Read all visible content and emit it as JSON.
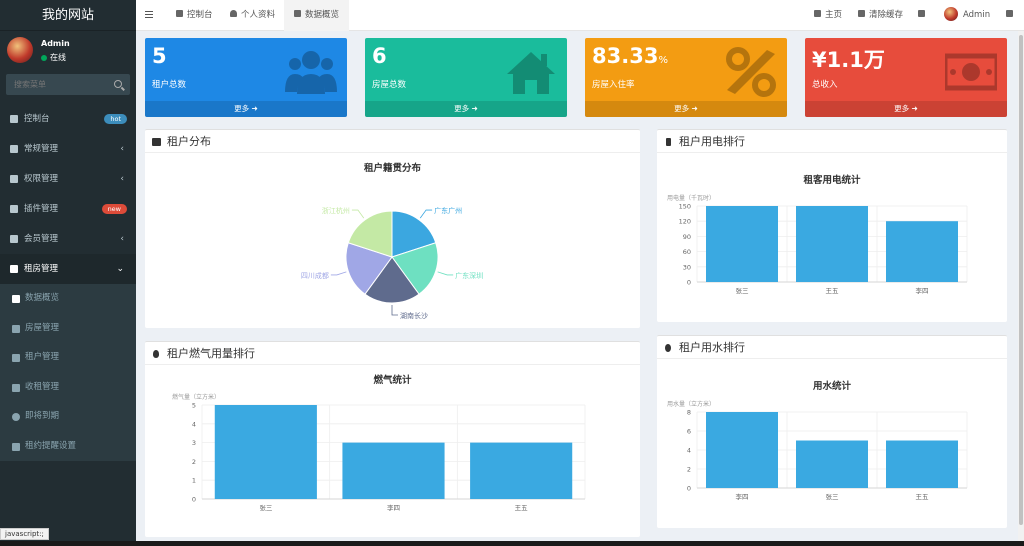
{
  "sidebar": {
    "brand": "我的网站",
    "user": {
      "name": "Admin",
      "status": "在线"
    },
    "search_placeholder": "搜索菜单",
    "items": [
      {
        "label": "控制台",
        "badge": "hot",
        "badge_color": "#3c8dbc"
      },
      {
        "label": "常规管理",
        "arrow": "‹"
      },
      {
        "label": "权限管理",
        "arrow": "‹"
      },
      {
        "label": "插件管理",
        "badge": "new",
        "badge_color": "#dd4b39"
      },
      {
        "label": "会员管理",
        "arrow": "‹"
      },
      {
        "label": "租房管理",
        "arrow": "⌄"
      }
    ],
    "subitems": [
      {
        "label": "数据概览"
      },
      {
        "label": "房屋管理"
      },
      {
        "label": "租户管理"
      },
      {
        "label": "收租管理"
      },
      {
        "label": "即将到期"
      },
      {
        "label": "租约提醒设置"
      }
    ]
  },
  "topbar": {
    "tabs": [
      {
        "label": "控制台"
      },
      {
        "label": "个人资料"
      },
      {
        "label": "数据概览"
      }
    ],
    "right": {
      "home": "主页",
      "clear_cache": "清除缓存",
      "user": "Admin"
    }
  },
  "cards": [
    {
      "value": "5",
      "unit": "",
      "label": "租户总数",
      "more": "更多",
      "color": "#1e88e5",
      "icon": "users-icon"
    },
    {
      "value": "6",
      "unit": "",
      "label": "房屋总数",
      "more": "更多",
      "color": "#1abc9c",
      "icon": "home-icon"
    },
    {
      "value": "83.33",
      "unit": "%",
      "label": "房屋入住率",
      "more": "更多",
      "color": "#f39c12",
      "icon": "percent-icon"
    },
    {
      "value": "¥1.1万",
      "unit": "",
      "label": "总收入",
      "more": "更多",
      "color": "#e74c3c",
      "icon": "money-icon"
    }
  ],
  "panels": {
    "tenant_dist": {
      "title": "租户分布"
    },
    "electric": {
      "title": "租户用电排行"
    },
    "gas": {
      "title": "租户燃气用量排行"
    },
    "water": {
      "title": "租户用水排行"
    }
  },
  "status_bar": "javascript:;",
  "chart_data": [
    {
      "type": "pie",
      "title": "租户籍贯分布",
      "categories": [
        "广东广州",
        "广东深圳",
        "湖南长沙",
        "四川成都",
        "浙江杭州"
      ],
      "values": [
        1,
        1,
        1,
        1,
        1
      ],
      "colors": [
        "#3ba7e0",
        "#6ee0c1",
        "#5f6b8d",
        "#a0a7e6",
        "#c4e9a5"
      ]
    },
    {
      "type": "bar",
      "title": "租客用电统计",
      "ylabel": "用电量（千瓦时）",
      "categories": [
        "张三",
        "王五",
        "李四"
      ],
      "values": [
        150,
        150,
        120
      ],
      "ylim": [
        0,
        150
      ],
      "yticks": [
        0,
        30,
        60,
        90,
        120,
        150
      ],
      "color": "#3aa9e1"
    },
    {
      "type": "bar",
      "title": "燃气统计",
      "ylabel": "燃气量（立方米）",
      "categories": [
        "张三",
        "李四",
        "王五"
      ],
      "values": [
        5,
        3,
        3
      ],
      "ylim": [
        0,
        5
      ],
      "yticks": [
        0,
        1,
        2,
        3,
        4,
        5
      ],
      "color": "#3aa9e1"
    },
    {
      "type": "bar",
      "title": "用水统计",
      "ylabel": "用水量（立方米）",
      "categories": [
        "李四",
        "张三",
        "王五"
      ],
      "values": [
        8,
        5,
        5
      ],
      "ylim": [
        0,
        8
      ],
      "yticks": [
        0,
        2,
        4,
        6,
        8
      ],
      "color": "#3aa9e1"
    }
  ]
}
